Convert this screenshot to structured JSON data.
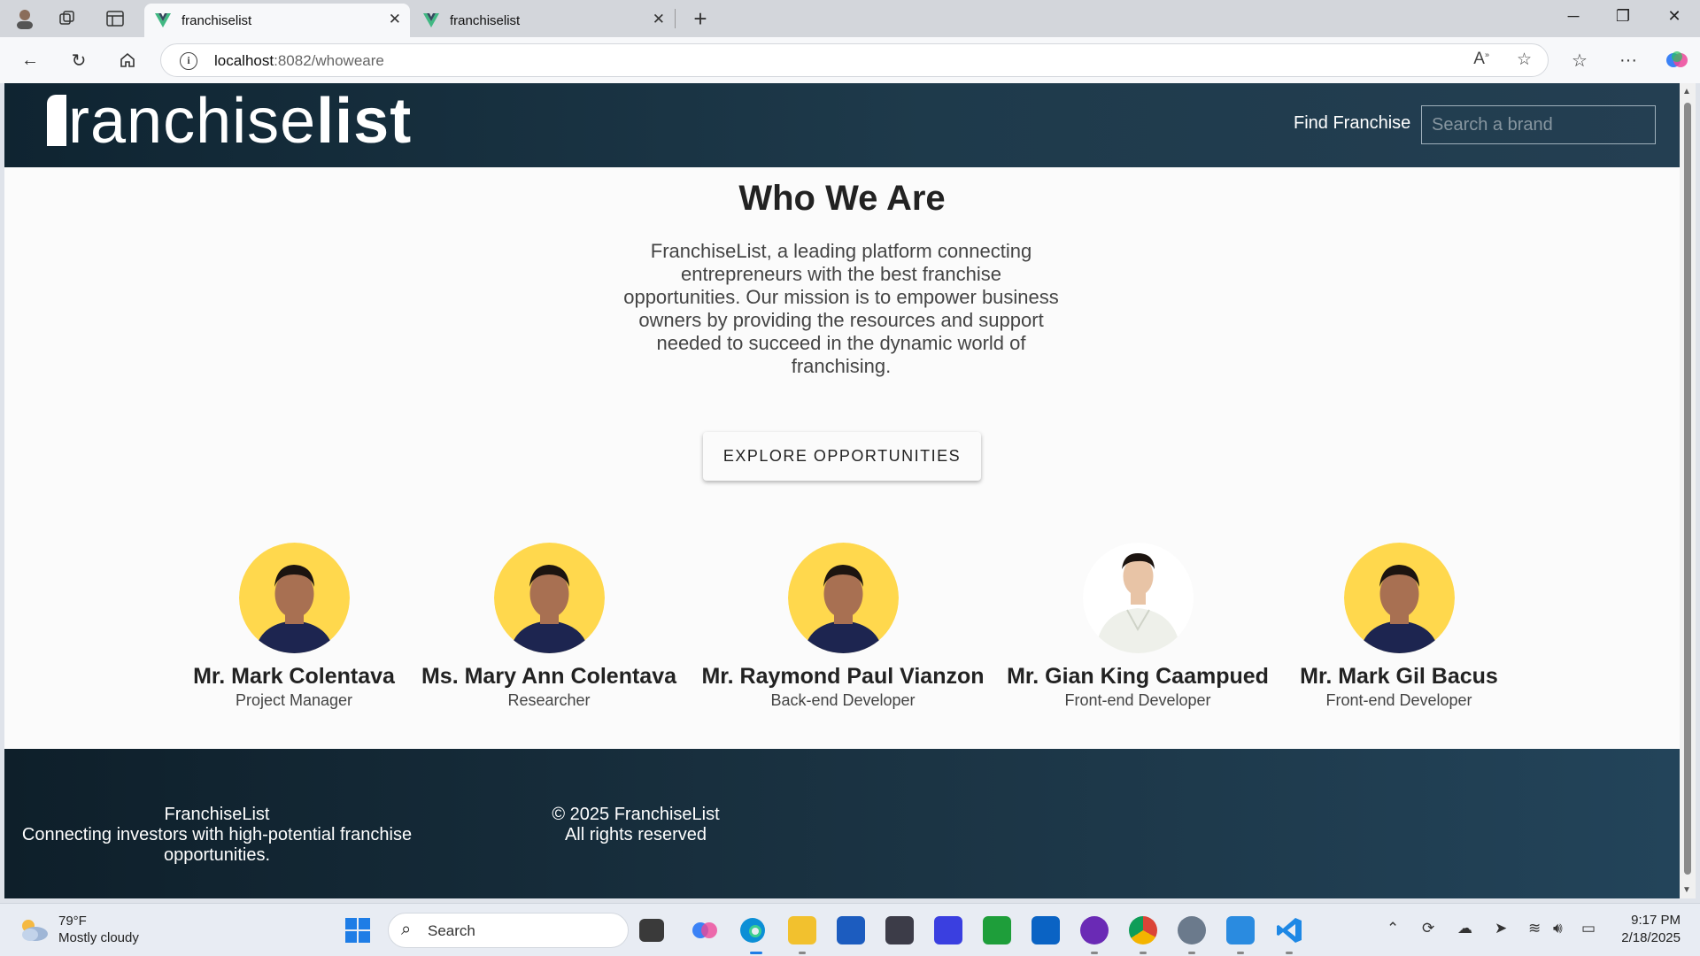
{
  "browser": {
    "tabs": [
      {
        "title": "franchiselist",
        "active": true
      },
      {
        "title": "franchiselist",
        "active": false
      }
    ],
    "address": {
      "host": "localhost",
      "path": ":8082/whoweare"
    }
  },
  "header": {
    "logo_light": "ranchise",
    "logo_bold": "list",
    "find_link": "Find Franchise",
    "search_placeholder": "Search a brand"
  },
  "main": {
    "title": "Who We Are",
    "intro": "FranchiseList, a leading platform connecting entrepreneurs with the best franchise opportunities. Our mission is to empower business owners by providing the resources and support needed to succeed in the dynamic world of franchising.",
    "cta": "EXPLORE OPPORTUNITIES"
  },
  "team": [
    {
      "name": "Mr. Mark Colentava",
      "role": "Project Manager",
      "photo": "yellow-background-portrait"
    },
    {
      "name": "Ms. Mary Ann Colentava",
      "role": "Researcher",
      "photo": "yellow-background-portrait"
    },
    {
      "name": "Mr. Raymond Paul Vianzon",
      "role": "Back-end Developer",
      "photo": "yellow-background-portrait"
    },
    {
      "name": "Mr. Gian King Caampued",
      "role": "Front-end Developer",
      "photo": "white-background-portrait"
    },
    {
      "name": "Mr. Mark Gil Bacus",
      "role": "Front-end Developer",
      "photo": "yellow-background-portrait"
    }
  ],
  "footer": {
    "brand": "FranchiseList",
    "tagline": "Connecting investors with high-potential franchise opportunities.",
    "copyright": "© 2025 FranchiseList",
    "rights": "All rights reserved"
  },
  "taskbar": {
    "temp": "79°F",
    "weather": "Mostly cloudy",
    "search_label": "Search",
    "time": "9:17 PM",
    "date": "2/18/2025"
  },
  "colors": {
    "header_dark": "#0f2431",
    "header_light": "#243f52",
    "avatar_yellow": "#ffd84d",
    "shirt_navy": "#1d2550"
  }
}
